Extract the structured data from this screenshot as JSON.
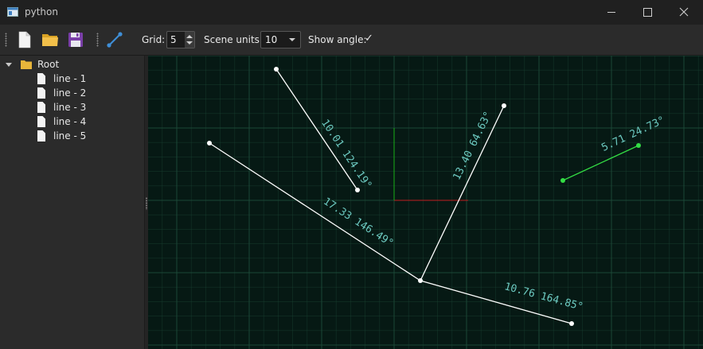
{
  "window": {
    "title": "python"
  },
  "toolbar": {
    "grid_label": "Grid:",
    "grid_value": "5",
    "scene_units_label": "Scene units:",
    "scene_units_value": "10",
    "show_angle_label": "Show angle:",
    "show_angle_check": "✓"
  },
  "tree": {
    "root": "Root",
    "items": [
      "line - 1",
      "line - 2",
      "line - 3",
      "line - 4",
      "line - 5"
    ]
  },
  "scene": {
    "lines": [
      {
        "id": "line-1",
        "label": "10.01 124.19°",
        "color": "#ffffff"
      },
      {
        "id": "line-2",
        "label": "13.40 64.63°",
        "color": "#ffffff"
      },
      {
        "id": "line-3",
        "label": "5.71 24.73°",
        "color": "#33dd44"
      },
      {
        "id": "line-4",
        "label": "17.33 146.49°",
        "color": "#ffffff"
      },
      {
        "id": "line-5",
        "label": "10.76 164.85°",
        "color": "#ffffff"
      }
    ]
  },
  "colors": {
    "canvas_bg": "#061914",
    "grid": "#1d4a38",
    "label": "#6cc9c0",
    "axis_x": "#c02020",
    "axis_y": "#18b018"
  },
  "icons": {
    "app": "python-window-icon",
    "new": "new-file-icon",
    "open": "open-folder-icon",
    "save": "save-disk-icon",
    "line_tool": "draw-line-icon"
  }
}
